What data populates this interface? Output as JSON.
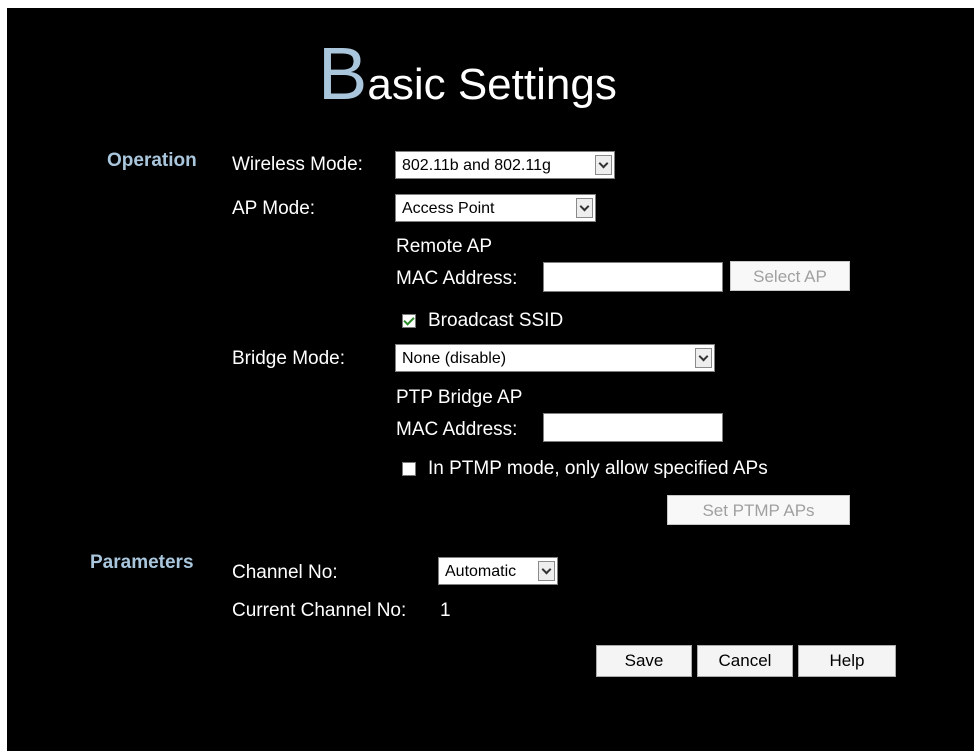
{
  "title": {
    "initial": "B",
    "rest": "asic Settings"
  },
  "operation": {
    "section_label": "Operation",
    "wireless_mode": {
      "label": "Wireless Mode:",
      "value": "802.11b and 802.11g"
    },
    "ap_mode": {
      "label": "AP Mode:",
      "value": "Access Point"
    },
    "remote_ap": {
      "line1": "Remote AP",
      "line2": "MAC Address:",
      "value": "",
      "button": "Select AP"
    },
    "broadcast_ssid": {
      "label": "Broadcast SSID",
      "checked": true
    },
    "bridge_mode": {
      "label": "Bridge Mode:",
      "value": "None (disable)"
    },
    "ptp_bridge": {
      "line1": "PTP Bridge AP",
      "line2": "MAC Address:",
      "value": ""
    },
    "ptmp_only": {
      "label": "In PTMP mode, only allow specified APs",
      "checked": false
    },
    "set_ptmp_button": "Set PTMP APs"
  },
  "parameters": {
    "section_label": "Parameters",
    "channel_no": {
      "label": "Channel No:",
      "value": "Automatic"
    },
    "current_channel": {
      "label": "Current Channel No:",
      "value": "1"
    }
  },
  "actions": {
    "save": "Save",
    "cancel": "Cancel",
    "help": "Help"
  }
}
